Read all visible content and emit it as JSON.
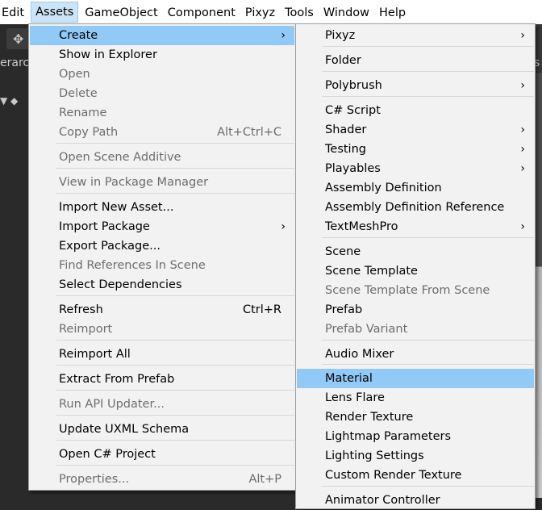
{
  "menubar": [
    {
      "label": "Edit",
      "active": false
    },
    {
      "label": "Assets",
      "active": true
    },
    {
      "label": "GameObject",
      "active": false
    },
    {
      "label": "Component",
      "active": false
    },
    {
      "label": "Pixyz",
      "active": false
    },
    {
      "label": "Tools",
      "active": false
    },
    {
      "label": "Window",
      "active": false
    },
    {
      "label": "Help",
      "active": false
    }
  ],
  "background": {
    "hierarchy_fragment": "erarc",
    "right_fragment": "s"
  },
  "assets_menu": {
    "items": [
      {
        "label": "Create",
        "submenu": true,
        "highlighted": true
      },
      {
        "label": "Show in Explorer"
      },
      {
        "label": "Open",
        "disabled": true
      },
      {
        "label": "Delete",
        "disabled": true
      },
      {
        "label": "Rename",
        "disabled": true
      },
      {
        "label": "Copy Path",
        "shortcut": "Alt+Ctrl+C",
        "disabled": true
      },
      {
        "label": "Open Scene Additive",
        "disabled": true
      },
      {
        "label": "View in Package Manager",
        "disabled": true
      },
      {
        "label": "Import New Asset..."
      },
      {
        "label": "Import Package",
        "submenu": true
      },
      {
        "label": "Export Package..."
      },
      {
        "label": "Find References In Scene",
        "disabled": true
      },
      {
        "label": "Select Dependencies"
      },
      {
        "label": "Refresh",
        "shortcut": "Ctrl+R"
      },
      {
        "label": "Reimport",
        "disabled": true
      },
      {
        "label": "Reimport All"
      },
      {
        "label": "Extract From Prefab"
      },
      {
        "label": "Run API Updater...",
        "disabled": true
      },
      {
        "label": "Update UXML Schema"
      },
      {
        "label": "Open C# Project"
      },
      {
        "label": "Properties...",
        "shortcut": "Alt+P",
        "disabled": true
      }
    ]
  },
  "create_menu": {
    "items": [
      {
        "label": "Pixyz",
        "submenu": true
      },
      {
        "label": "Folder"
      },
      {
        "label": "Polybrush",
        "submenu": true
      },
      {
        "label": "C# Script"
      },
      {
        "label": "Shader",
        "submenu": true
      },
      {
        "label": "Testing",
        "submenu": true
      },
      {
        "label": "Playables",
        "submenu": true
      },
      {
        "label": "Assembly Definition"
      },
      {
        "label": "Assembly Definition Reference"
      },
      {
        "label": "TextMeshPro",
        "submenu": true
      },
      {
        "label": "Scene"
      },
      {
        "label": "Scene Template"
      },
      {
        "label": "Scene Template From Scene",
        "disabled": true
      },
      {
        "label": "Prefab"
      },
      {
        "label": "Prefab Variant",
        "disabled": true
      },
      {
        "label": "Audio Mixer"
      },
      {
        "label": "Material",
        "highlighted": true
      },
      {
        "label": "Lens Flare"
      },
      {
        "label": "Render Texture"
      },
      {
        "label": "Lightmap Parameters"
      },
      {
        "label": "Lighting Settings"
      },
      {
        "label": "Custom Render Texture"
      },
      {
        "label": "Animator Controller"
      }
    ]
  },
  "glyphs": {
    "submenu_arrow": "›"
  }
}
